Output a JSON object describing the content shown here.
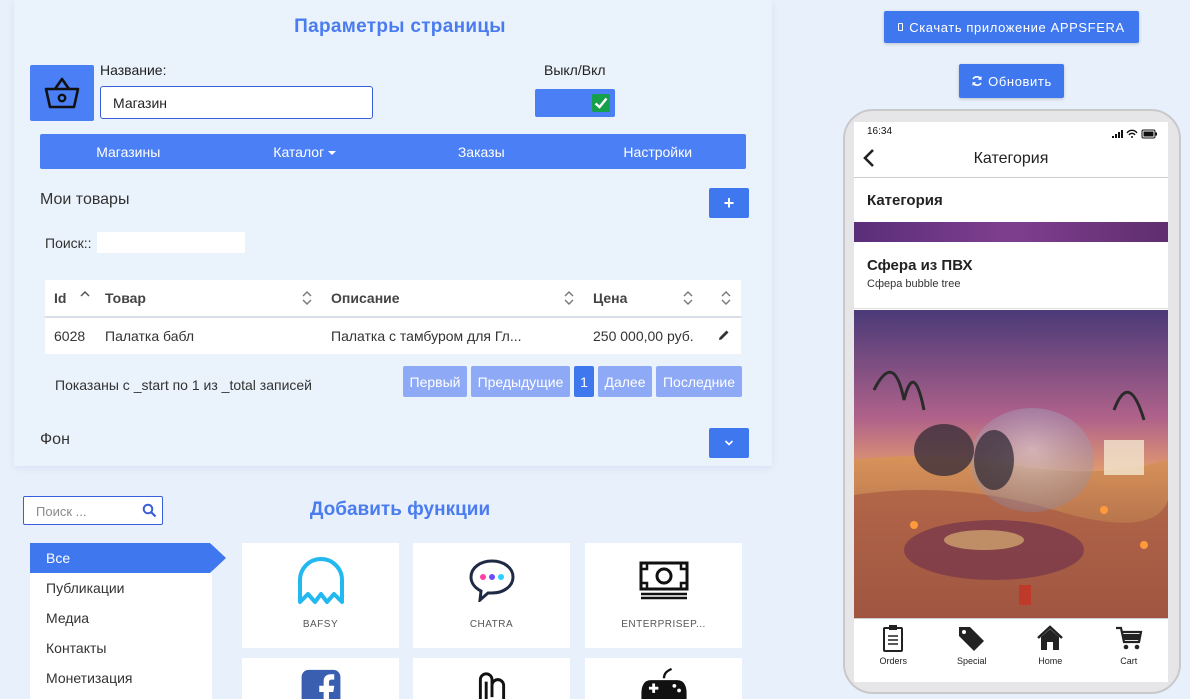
{
  "params": {
    "title": "Параметры страницы",
    "name_label": "Название:",
    "name_value": "Магазин",
    "toggle_label": "Выкл/Вкл",
    "toggle_on": true
  },
  "nav": {
    "items": [
      "Магазины",
      "Каталог",
      "Заказы",
      "Настройки"
    ]
  },
  "products": {
    "title": "Мои товары",
    "add_label": "+",
    "search_label": "Поиск::",
    "columns": [
      "Id",
      "Товар",
      "Описание",
      "Цена"
    ],
    "rows": [
      {
        "id": "6028",
        "name": "Палатка бабл",
        "description": "Палатка с тамбуром для Гл...",
        "price": "250 000,00 руб."
      }
    ],
    "showing": "Показаны с _start по 1 из _total записей",
    "pagination": [
      "Первый",
      "Предыдущие",
      "1",
      "Далее",
      "Последние"
    ]
  },
  "background": {
    "title": "Фон"
  },
  "functions": {
    "title": "Добавить функции",
    "search_placeholder": "Поиск ...",
    "categories": [
      "Все",
      "Публикации",
      "Медиа",
      "Контакты",
      "Монетизация"
    ],
    "cards": [
      {
        "label": "BAFSY",
        "icon": "bafsy-icon"
      },
      {
        "label": "CHATRA",
        "icon": "chat-bubble-icon"
      },
      {
        "label": "ENTERPRISEP...",
        "icon": "money-icon"
      },
      {
        "label": "",
        "icon": "facebook-icon"
      },
      {
        "label": "",
        "icon": "attachment-icon"
      },
      {
        "label": "",
        "icon": "gamepad-icon"
      }
    ]
  },
  "right": {
    "download_label": "Скачать приложение APPSFERA",
    "refresh_label": "Обновить"
  },
  "phone": {
    "time": "16:34",
    "header_title": "Категория",
    "category_heading": "Категория",
    "item_title": "Сфера из ПВХ",
    "item_subtitle": "Сфера bubble tree",
    "tabs": [
      "Orders",
      "Special",
      "Home",
      "Cart"
    ]
  },
  "colors": {
    "accent": "#3f77ef",
    "title_blue": "#4a7cf0",
    "check_green": "#16a04a"
  }
}
